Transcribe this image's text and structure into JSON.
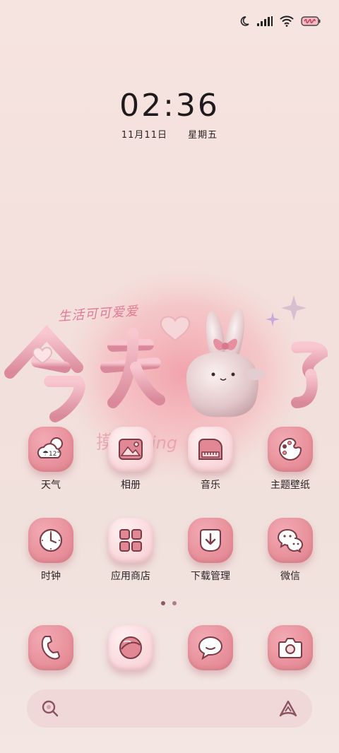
{
  "status_bar": {
    "icons": [
      "moon-icon",
      "signal-icon",
      "wifi-icon",
      "battery-icon"
    ]
  },
  "lockclock": {
    "time": "02:36",
    "date": "11月11日",
    "weekday": "星期五"
  },
  "wallpaper": {
    "tagline": "生活可可爱爱"
  },
  "weather_widget": {
    "temp": "12°"
  },
  "apps": [
    {
      "label": "天气",
      "icon": "weather-icon"
    },
    {
      "label": "相册",
      "icon": "gallery-icon"
    },
    {
      "label": "音乐",
      "icon": "music-icon"
    },
    {
      "label": "主题壁纸",
      "icon": "theme-icon"
    },
    {
      "label": "时钟",
      "icon": "clock-icon"
    },
    {
      "label": "应用商店",
      "icon": "app-store-icon"
    },
    {
      "label": "下载管理",
      "icon": "download-icon"
    },
    {
      "label": "微信",
      "icon": "wechat-icon"
    }
  ],
  "dock": [
    {
      "icon": "phone-icon"
    },
    {
      "icon": "browser-icon"
    },
    {
      "icon": "message-icon"
    },
    {
      "icon": "camera-icon"
    }
  ],
  "pager": {
    "pages": 2,
    "current": 1
  },
  "colors": {
    "accent": "#e8919c",
    "accent_light": "#fadadd",
    "line": "#7a3b46"
  }
}
